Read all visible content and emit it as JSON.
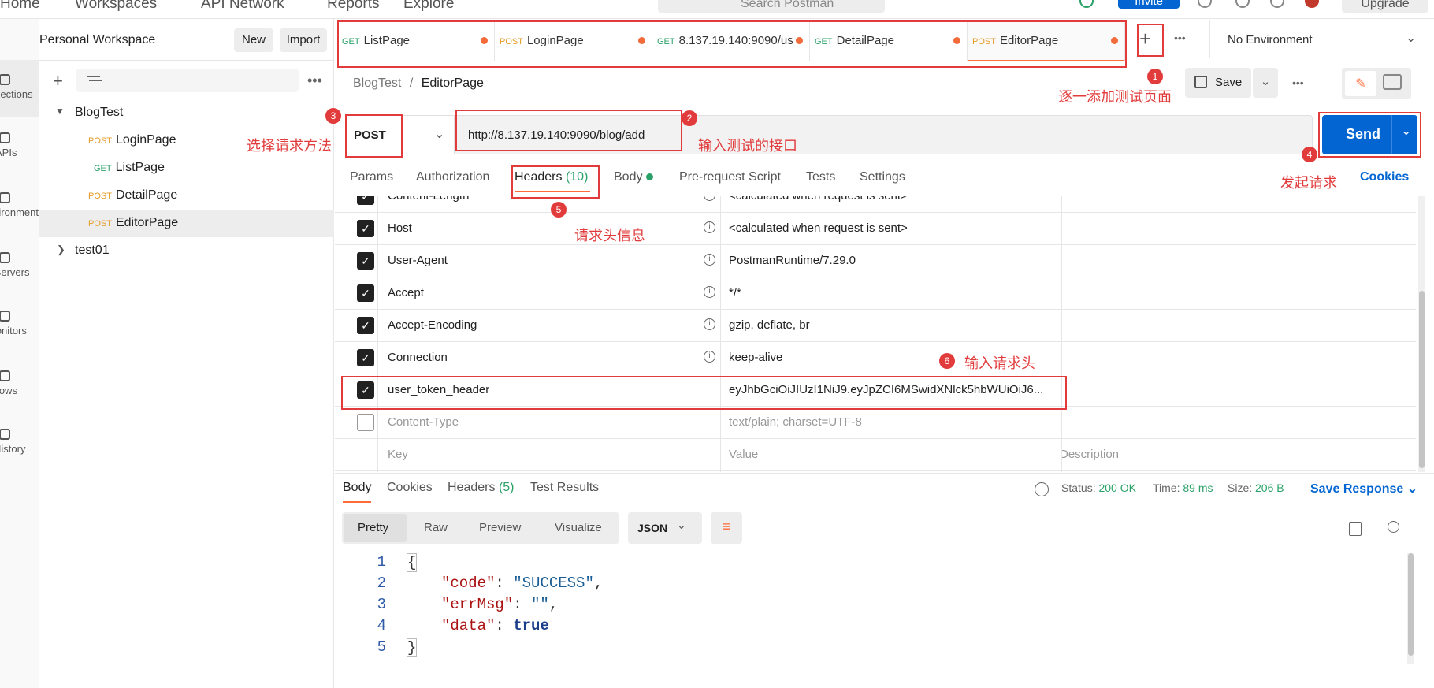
{
  "topbar": {
    "nav": [
      "Home",
      "Workspaces",
      "API Network",
      "Reports",
      "Explore"
    ],
    "search_placeholder": "Search Postman",
    "invite": "Invite",
    "upgrade": "Upgrade"
  },
  "rail": {
    "items": [
      "Collections",
      "APIs",
      "Environments",
      "Mock Servers",
      "Monitors",
      "Flows",
      "History"
    ]
  },
  "sidebar": {
    "workspace_title": "Personal Workspace",
    "new": "New",
    "import": "Import",
    "tree": [
      {
        "label": "BlogTest",
        "type": "collection"
      },
      {
        "method": "POST",
        "label": "LoginPage"
      },
      {
        "method": "GET",
        "label": "ListPage"
      },
      {
        "method": "POST",
        "label": "DetailPage"
      },
      {
        "method": "POST",
        "label": "EditorPage"
      },
      {
        "label": "test01",
        "type": "collection"
      }
    ]
  },
  "tabs": [
    {
      "method": "GET",
      "label": "ListPage"
    },
    {
      "method": "POST",
      "label": "LoginPage"
    },
    {
      "method": "GET",
      "label": "8.137.19.140:9090/us"
    },
    {
      "method": "GET",
      "label": "DetailPage"
    },
    {
      "method": "POST",
      "label": "EditorPage"
    }
  ],
  "environment": "No Environment",
  "breadcrumb": {
    "parent": "BlogTest",
    "sep": "/",
    "current": "EditorPage"
  },
  "save": "Save",
  "request": {
    "method": "POST",
    "url": "http://8.137.19.140:9090/blog/add",
    "send": "Send"
  },
  "request_tabs": {
    "params": "Params",
    "authorization": "Authorization",
    "headers": "Headers",
    "headers_count": "(10)",
    "body": "Body",
    "prerequest": "Pre-request Script",
    "tests": "Tests",
    "settings": "Settings",
    "cookies": "Cookies"
  },
  "headers": [
    {
      "key": "Content-Length",
      "value": "<calculated when request is sent>",
      "checked": true
    },
    {
      "key": "Host",
      "value": "<calculated when request is sent>",
      "checked": true
    },
    {
      "key": "User-Agent",
      "value": "PostmanRuntime/7.29.0",
      "checked": true
    },
    {
      "key": "Accept",
      "value": "*/*",
      "checked": true
    },
    {
      "key": "Accept-Encoding",
      "value": "gzip, deflate, br",
      "checked": true
    },
    {
      "key": "Connection",
      "value": "keep-alive",
      "checked": true
    },
    {
      "key": "user_token_header",
      "value": "eyJhbGciOiJIUzI1NiJ9.eyJpZCI6MSwidXNlck5hbWUiOiJ6...",
      "checked": true
    },
    {
      "key": "Content-Type",
      "value": "text/plain; charset=UTF-8",
      "checked": false
    }
  ],
  "header_placeholders": {
    "key": "Key",
    "value": "Value",
    "description": "Description"
  },
  "response": {
    "tabs": {
      "body": "Body",
      "cookies": "Cookies",
      "headers": "Headers",
      "headers_count": "(5)",
      "test_results": "Test Results"
    },
    "status_label": "Status:",
    "status": "200 OK",
    "time_label": "Time:",
    "time": "89 ms",
    "size_label": "Size:",
    "size": "206 B",
    "save_response": "Save Response",
    "view_tabs": [
      "Pretty",
      "Raw",
      "Preview",
      "Visualize"
    ],
    "format": "JSON",
    "lines": [
      "1",
      "2",
      "3",
      "4",
      "5"
    ],
    "code": {
      "open": "{",
      "k1": "\"code\"",
      "v1": "\"SUCCESS\"",
      "k2": "\"errMsg\"",
      "v2": "\"\"",
      "k3": "\"data\"",
      "v3": "true",
      "close": "}"
    }
  },
  "annotations": [
    {
      "n": "1",
      "text": "逐一添加测试页面"
    },
    {
      "n": "2",
      "text": "输入测试的接口"
    },
    {
      "n": "3",
      "text": "选择请求方法"
    },
    {
      "n": "4",
      "text": "发起请求"
    },
    {
      "n": "5",
      "text": "请求头信息"
    },
    {
      "n": "6",
      "text": "输入请求头"
    }
  ],
  "colors": {
    "accent": "#ff6c37",
    "primary": "#0265d2",
    "annotation": "#e23b3b",
    "status_ok": "#2aa168"
  }
}
